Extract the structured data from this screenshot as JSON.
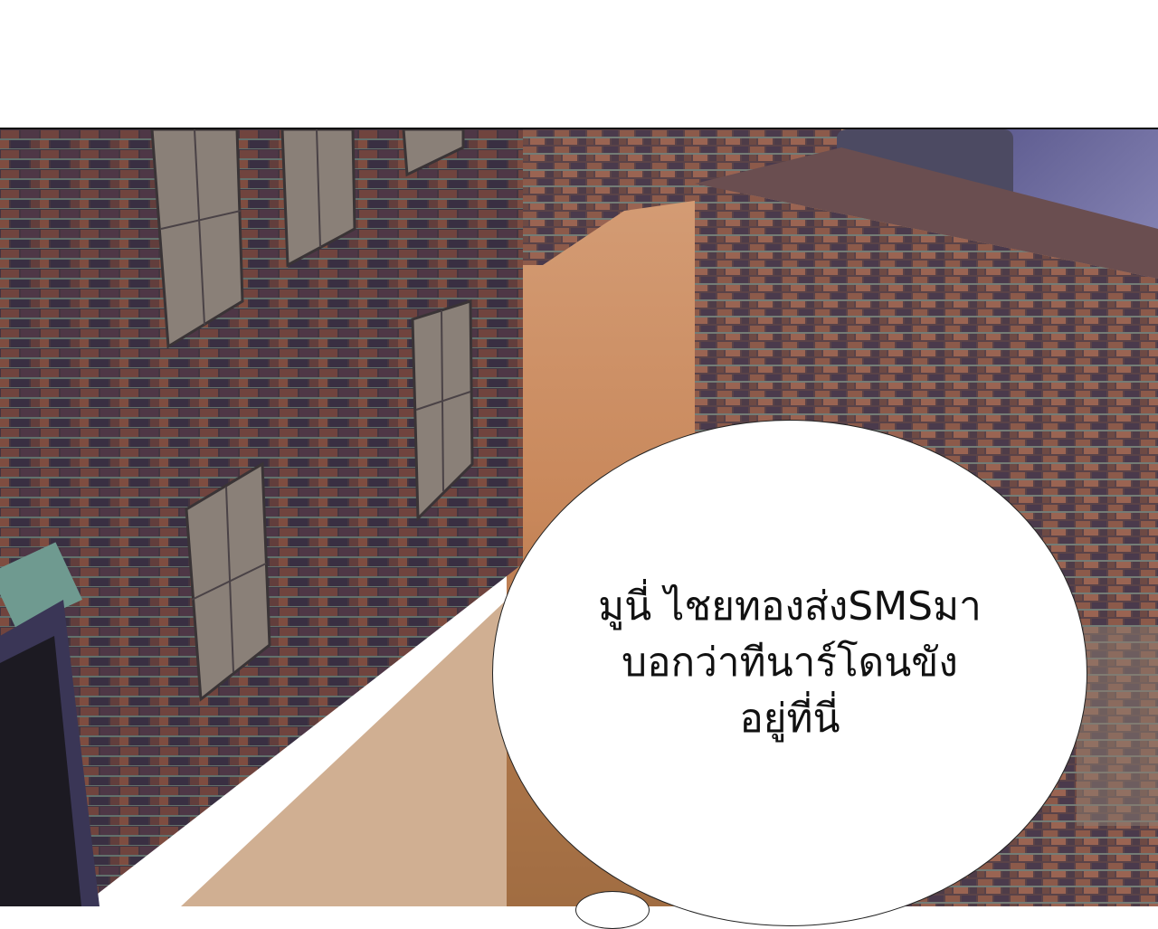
{
  "comic_panel": {
    "speech_bubble": {
      "lines": [
        "มูนี่ ไชยทองส่งSMSมา",
        "บอกว่าทีนาร์โดนขัง",
        "อยู่ที่นี่"
      ]
    }
  },
  "palette": {
    "brick_dark": "#4a3a46",
    "brick_red": "#8a4b3f",
    "mortar": "#7fa596",
    "floor_warm": "#c89063",
    "roof_purple": "#6c6a9c",
    "tank": "#4c4a62",
    "bubble": "#ffffff"
  }
}
